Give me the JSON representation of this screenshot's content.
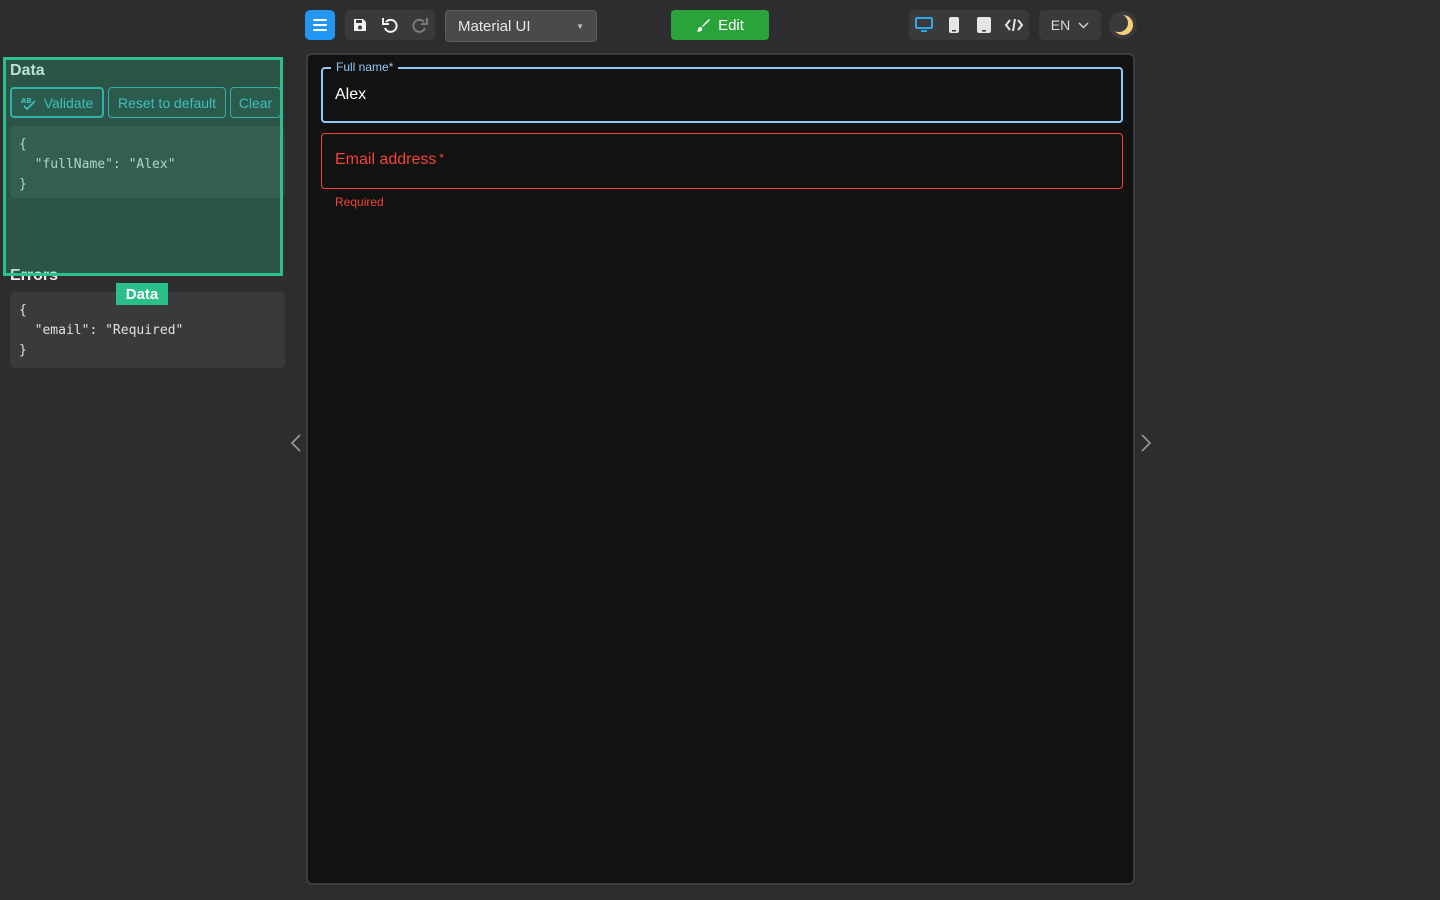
{
  "toolbar": {
    "theme_select": "Material UI",
    "edit_label": "Edit",
    "language": "EN"
  },
  "left_panel": {
    "data_title": "Data",
    "buttons": {
      "validate": "Validate",
      "reset": "Reset to default",
      "clear": "Clear"
    },
    "data_json": "{\n  \"fullName\": \"Alex\"\n}",
    "errors_title": "Errors",
    "errors_json": "{\n  \"email\": \"Required\"\n}",
    "highlight_label": "Data"
  },
  "form": {
    "full_name": {
      "label": "Full name",
      "required_mark": "*",
      "value": "Alex"
    },
    "email": {
      "label": "Email address",
      "required_mark": "*",
      "value": "",
      "helper": "Required"
    }
  },
  "colors": {
    "accent": "#2196f3",
    "edit_green": "#2ba33b",
    "highlight": "#2bbf8a",
    "error": "#f44336",
    "focus": "#90caf9"
  },
  "icons": [
    "menu-icon",
    "save-icon",
    "undo-icon",
    "redo-icon",
    "brush-icon",
    "desktop-icon",
    "mobile-icon",
    "tablet-icon",
    "code-icon",
    "chevron-down-icon",
    "moon-icon",
    "spellcheck-icon",
    "chevron-left-icon",
    "chevron-right-icon"
  ]
}
